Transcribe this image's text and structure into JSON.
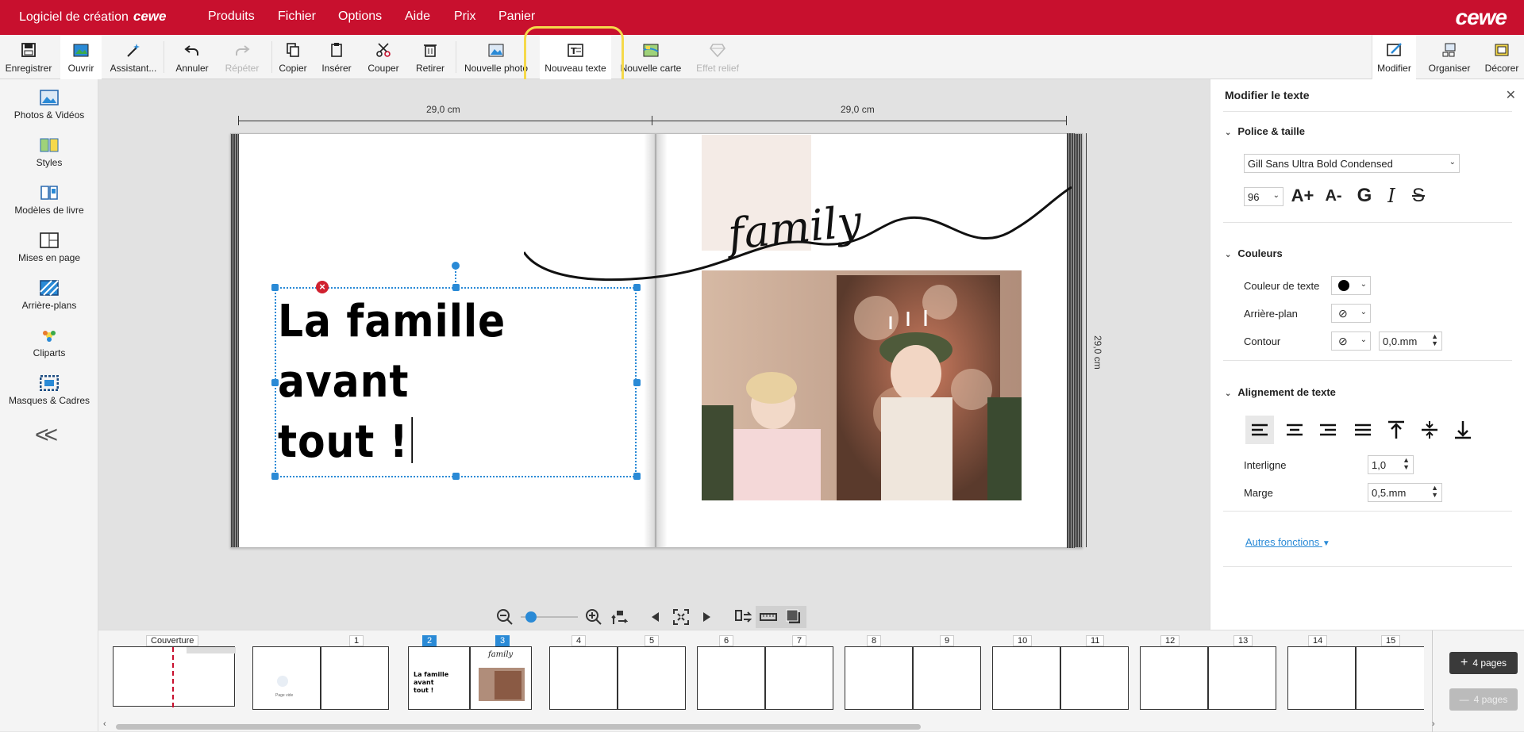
{
  "titlebar": {
    "app_title": "Logiciel de création",
    "app_brand_small": "cewe",
    "brand": "cewe",
    "menu": [
      "Produits",
      "Fichier",
      "Options",
      "Aide",
      "Prix",
      "Panier"
    ]
  },
  "toolbar": {
    "save": "Enregistrer",
    "open": "Ouvrir",
    "assistant": "Assistant...",
    "undo": "Annuler",
    "redo": "Répéter",
    "copy": "Copier",
    "paste": "Insérer",
    "cut": "Couper",
    "remove": "Retirer",
    "new_photo": "Nouvelle photo",
    "new_text": "Nouveau texte",
    "new_map": "Nouvelle carte",
    "relief": "Effet relief",
    "modify": "Modifier",
    "organize": "Organiser",
    "decorate": "Décorer"
  },
  "sidebar": {
    "items": [
      "Photos & Vidéos",
      "Styles",
      "Modèles de livre",
      "Mises en page",
      "Arrière-plans",
      "Cliparts",
      "Masques & Cadres"
    ],
    "collapse": "<<"
  },
  "canvas": {
    "ruler_left": "29,0 cm",
    "ruler_right": "29,0 cm",
    "ruler_vertical": "29,0 cm",
    "text_line1": "La famille avant",
    "text_line2": "tout !",
    "script_word": "family"
  },
  "strip": {
    "cover_label": "Couverture",
    "pages": [
      "1",
      "2",
      "3",
      "4",
      "5",
      "6",
      "7",
      "8",
      "9",
      "10",
      "11",
      "12",
      "13",
      "14",
      "15"
    ],
    "selected": [
      "2",
      "3"
    ],
    "add_pages": "4 pages",
    "add_pages_disabled": "4 pages",
    "blank_page_label": "Page vide"
  },
  "panel": {
    "title": "Modifier le texte",
    "font_section": "Police & taille",
    "font_name": "Gill Sans Ultra Bold Condensed",
    "font_size": "96",
    "grow_label": "A+",
    "shrink_label": "A-",
    "bold_label": "G",
    "italic_label": "I",
    "strike_label": "S",
    "colors_section": "Couleurs",
    "text_color_label": "Couleur de texte",
    "text_color": "#000000",
    "background_label": "Arrière-plan",
    "outline_label": "Contour",
    "outline_value": "0,0.mm",
    "align_section": "Alignement de texte",
    "line_spacing_label": "Interligne",
    "line_spacing_value": "1,0",
    "margin_label": "Marge",
    "margin_value": "0,5.mm",
    "more_functions": "Autres fonctions"
  },
  "colors": {
    "brand_red": "#c8102e",
    "accent_blue": "#2a8ad6",
    "highlight_yellow": "#f5d94a"
  }
}
